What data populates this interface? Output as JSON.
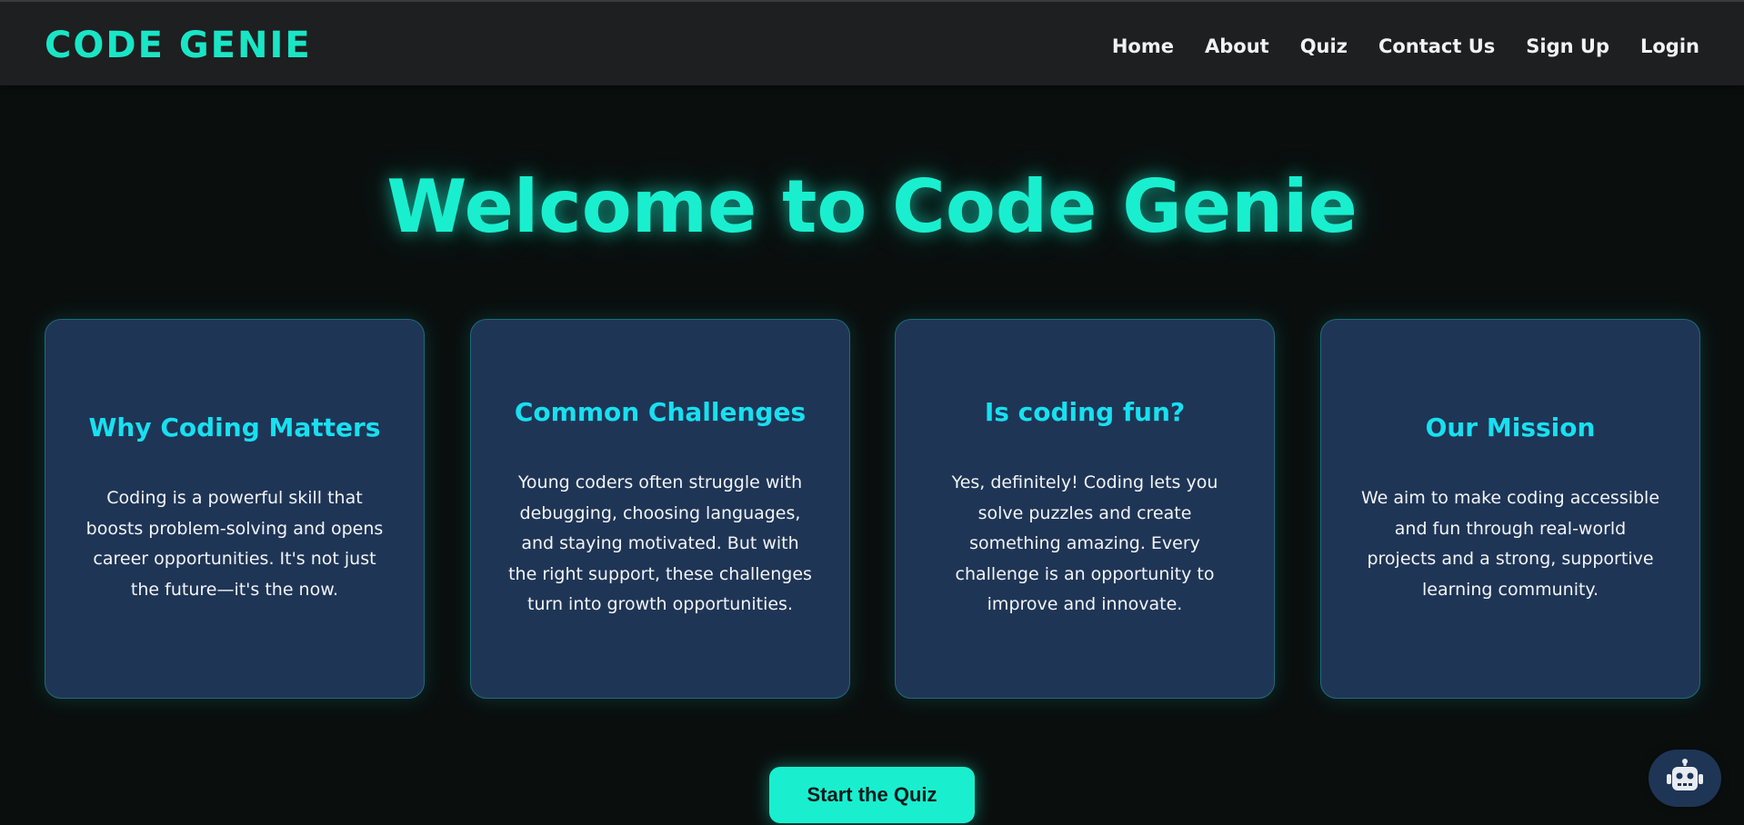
{
  "brand": "CODE GENIE",
  "nav": {
    "home": "Home",
    "about": "About",
    "quiz": "Quiz",
    "contact": "Contact Us",
    "signup": "Sign Up",
    "login": "Login"
  },
  "hero": {
    "title": "Welcome to Code Genie"
  },
  "cards": [
    {
      "title": "Why Coding Matters",
      "text": "Coding is a powerful skill that boosts problem-solving and opens career opportunities. It's not just the future—it's the now."
    },
    {
      "title": "Common Challenges",
      "text": "Young coders often struggle with debugging, choosing languages, and staying motivated. But with the right support, these challenges turn into growth opportunities."
    },
    {
      "title": "Is coding fun?",
      "text": "Yes, definitely! Coding lets you solve puzzles and create something amazing. Every challenge is an opportunity to improve and innovate."
    },
    {
      "title": "Our Mission",
      "text": "We aim to make coding accessible and fun through real-world projects and a strong, supportive learning community."
    }
  ],
  "cta": {
    "label": "Start the Quiz"
  },
  "chatbot": {
    "icon": "robot-icon"
  },
  "colors": {
    "accent": "#19efcf",
    "card_bg": "#1f3556",
    "card_title": "#18e0f0",
    "page_bg": "#0a0f0e",
    "navbar_bg": "#1e1f21"
  }
}
